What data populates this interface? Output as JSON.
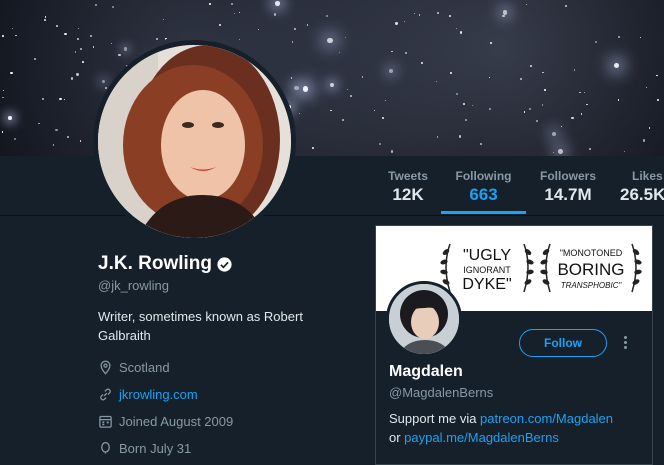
{
  "profile": {
    "name": "J.K. Rowling",
    "handle": "@jk_rowling",
    "bio": "Writer, sometimes known as Robert Galbraith",
    "location": "Scotland",
    "website": "jkrowling.com",
    "joined": "Joined August 2009",
    "born": "Born July 31"
  },
  "stats": [
    {
      "label": "Tweets",
      "value": "12K",
      "active": false
    },
    {
      "label": "Following",
      "value": "663",
      "active": true
    },
    {
      "label": "Followers",
      "value": "14.7M",
      "active": false
    },
    {
      "label": "Likes",
      "value": "26.5K",
      "active": false
    }
  ],
  "card": {
    "banner_text": {
      "left_line1": "\"UGLY",
      "left_line2": "IGNORANT",
      "left_line3": "DYKE\"",
      "right_line1": "\"MONOTONED",
      "right_line2": "BORING",
      "right_line3": "TRANSPHOBIC\""
    },
    "follow_label": "Follow",
    "name": "Magdalen",
    "handle": "@MagdalenBerns",
    "bio_prefix1": "Support me via ",
    "bio_link1": "patreon.com/Magdalen",
    "bio_prefix2": "or ",
    "bio_link2": "paypal.me/MagdalenBerns"
  },
  "colors": {
    "accent": "#1da1f2",
    "background": "#15202b",
    "muted": "#8899a6"
  },
  "icons": [
    "verified-badge-icon",
    "location-pin-icon",
    "link-icon",
    "calendar-icon",
    "balloon-icon",
    "more-vertical-icon"
  ]
}
